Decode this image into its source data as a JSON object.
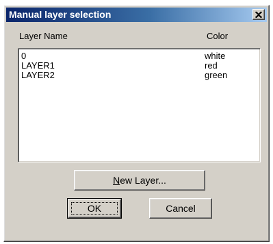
{
  "dialog": {
    "title": "Manual layer selection"
  },
  "columns": {
    "name_header": "Layer Name",
    "color_header": "Color"
  },
  "layers": [
    {
      "name": "0",
      "color": "white"
    },
    {
      "name": "LAYER1",
      "color": "red"
    },
    {
      "name": "LAYER2",
      "color": "green"
    }
  ],
  "buttons": {
    "new_layer_first": "N",
    "new_layer_rest": "ew Layer...",
    "ok": "OK",
    "cancel": "Cancel"
  },
  "icons": {
    "close": "close-icon"
  },
  "colors": {
    "titlebar_start": "#0a246a",
    "titlebar_end": "#a6caf0",
    "dialog_face": "#d4d0c8"
  }
}
